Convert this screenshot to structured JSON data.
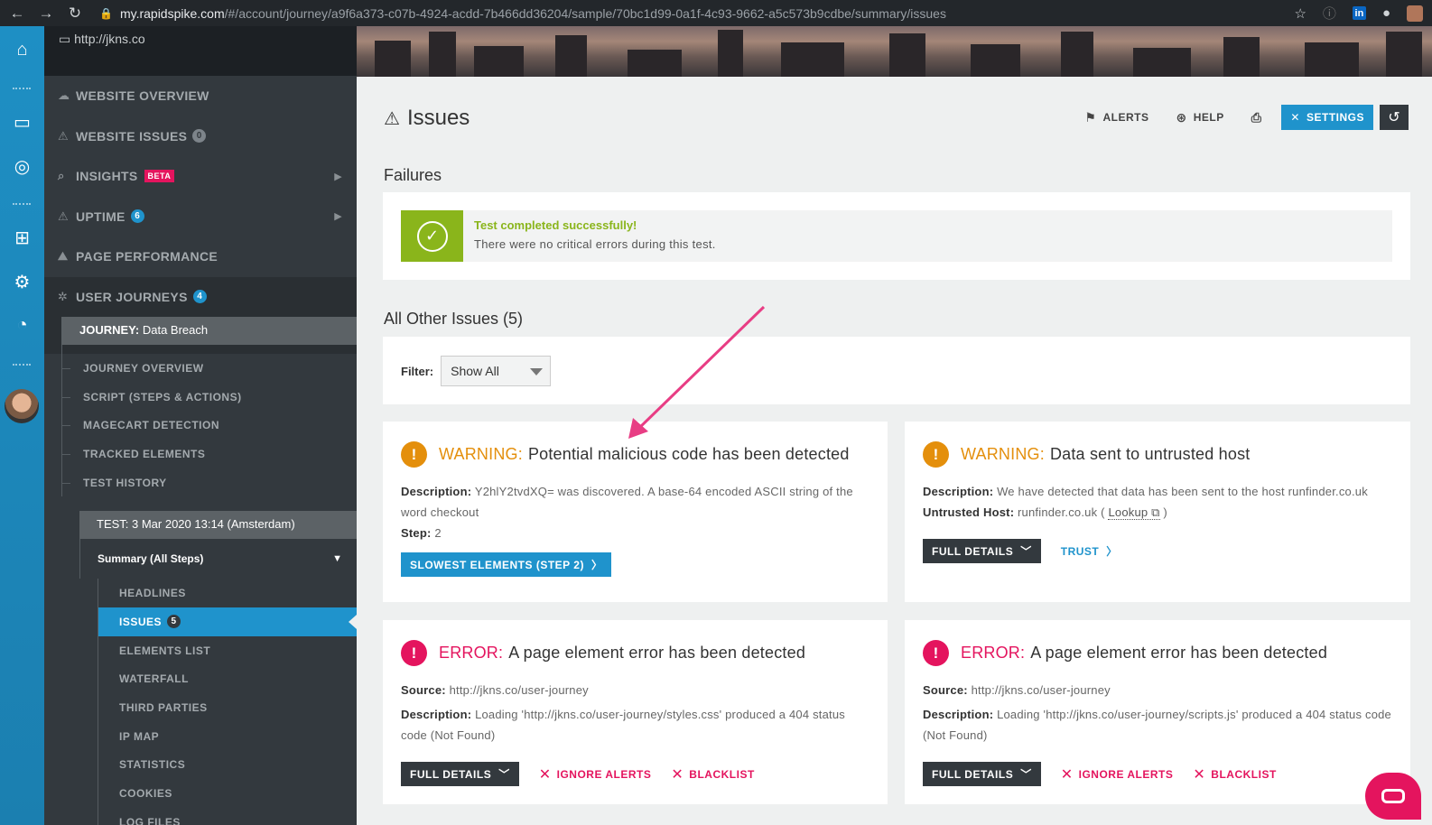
{
  "browser": {
    "url_host": "my.rapidspike.com",
    "url_path": "/#/account/journey/a9f6a373-c07b-4924-acdd-7b466dd36204/sample/70bc1d99-0a1f-4c93-9662-a5c573b9cdbe/summary/issues"
  },
  "sidebar": {
    "site": "http://jkns.co",
    "items": [
      {
        "label": "WEBSITE OVERVIEW"
      },
      {
        "label": "WEBSITE ISSUES",
        "badge": "0"
      },
      {
        "label": "INSIGHTS",
        "tag": "BETA"
      },
      {
        "label": "UPTIME",
        "badge": "6"
      },
      {
        "label": "PAGE PERFORMANCE"
      },
      {
        "label": "USER JOURNEYS",
        "badge": "4"
      }
    ],
    "journey_prefix": "JOURNEY:",
    "journey_name": "Data Breach",
    "journey_items": [
      "JOURNEY OVERVIEW",
      "SCRIPT (STEPS & ACTIONS)",
      "MAGECART DETECTION",
      "TRACKED ELEMENTS",
      "TEST HISTORY"
    ],
    "test_label": "TEST: 3 Mar 2020 13:14 (Amsterdam)",
    "summary_label": "Summary (All Steps)",
    "summary_items": [
      {
        "label": "HEADLINES"
      },
      {
        "label": "ISSUES",
        "badge": "5"
      },
      {
        "label": "ELEMENTS LIST"
      },
      {
        "label": "WATERFALL"
      },
      {
        "label": "THIRD PARTIES"
      },
      {
        "label": "IP MAP"
      },
      {
        "label": "STATISTICS"
      },
      {
        "label": "COOKIES"
      },
      {
        "label": "LOG FILES"
      }
    ]
  },
  "header": {
    "title": "Issues",
    "alerts": "ALERTS",
    "help": "HELP",
    "settings": "SETTINGS"
  },
  "failures": {
    "heading": "Failures",
    "title": "Test completed successfully!",
    "text": "There were no critical errors during this test."
  },
  "other": {
    "heading": "All Other Issues (5)",
    "filter_label": "Filter:",
    "filter_value": "Show All"
  },
  "issues": [
    {
      "level": "WARNING:",
      "title": "Potential malicious code has been detected",
      "desc_label": "Description:",
      "desc": "Y2hlY2tvdXQ= was discovered. A base-64 encoded ASCII string of the word checkout",
      "step_label": "Step:",
      "step": "2",
      "button": "SLOWEST ELEMENTS (STEP 2)"
    },
    {
      "level": "WARNING:",
      "title": "Data sent to untrusted host",
      "desc_label": "Description:",
      "desc": "We have detected that data has been sent to the host runfinder.co.uk",
      "host_label": "Untrusted Host:",
      "host": "runfinder.co.uk",
      "lookup": "Lookup",
      "button": "FULL DETAILS",
      "link": "TRUST"
    },
    {
      "level": "ERROR:",
      "title": "A page element error has been detected",
      "source_label": "Source:",
      "source": "http://jkns.co/user-journey",
      "desc_label": "Description:",
      "desc": "Loading 'http://jkns.co/user-journey/styles.css' produced a 404 status code (Not Found)",
      "button": "FULL DETAILS",
      "ignore": "IGNORE ALERTS",
      "blacklist": "BLACKLIST"
    },
    {
      "level": "ERROR:",
      "title": "A page element error has been detected",
      "source_label": "Source:",
      "source": "http://jkns.co/user-journey",
      "desc_label": "Description:",
      "desc": "Loading 'http://jkns.co/user-journey/scripts.js' produced a 404 status code (Not Found)",
      "button": "FULL DETAILS",
      "ignore": "IGNORE ALERTS",
      "blacklist": "BLACKLIST"
    }
  ],
  "colors": {
    "accent": "#1f93cc",
    "warning": "#e48f0c",
    "error": "#e4145e",
    "success": "#8ab51b",
    "sidebar": "#33393e"
  }
}
